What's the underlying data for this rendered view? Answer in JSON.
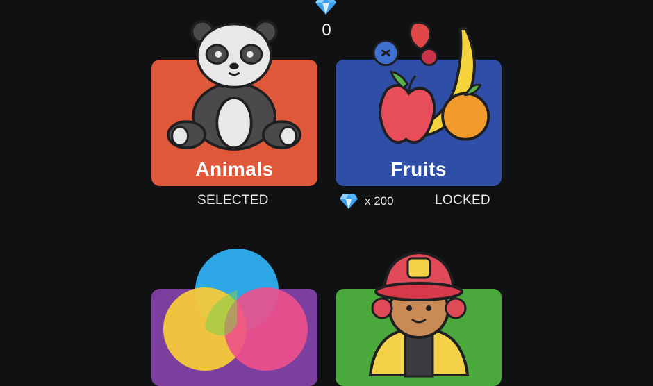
{
  "header": {
    "gem_icon": "diamond-icon",
    "gem_count": "0"
  },
  "categories": [
    {
      "title": "Animals",
      "color": "#e0583a",
      "icon": "panda-icon",
      "status": "SELECTED"
    },
    {
      "title": "Fruits",
      "color": "#2e4ea8",
      "icon": "fruits-icon",
      "price": "x 200",
      "status": "LOCKED"
    },
    {
      "title": "",
      "color": "#7b3fa0",
      "icon": "color-circles-icon"
    },
    {
      "title": "",
      "color": "#4aa83c",
      "icon": "firefighter-icon"
    }
  ],
  "colors": {
    "background": "#0f1112",
    "gem": "#3aa0f0"
  }
}
